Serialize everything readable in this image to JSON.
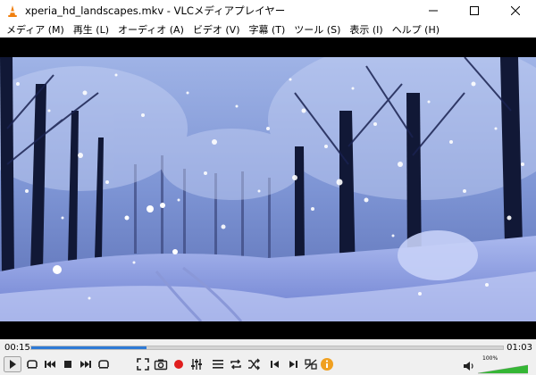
{
  "window": {
    "title": "xperia_hd_landscapes.mkv - VLCメディアプレイヤー"
  },
  "menu": [
    {
      "label": "メディア (M)"
    },
    {
      "label": "再生 (L)"
    },
    {
      "label": "オーディオ (A)"
    },
    {
      "label": "ビデオ (V)"
    },
    {
      "label": "字幕 (T)"
    },
    {
      "label": "ツール (S)"
    },
    {
      "label": "表示 (I)"
    },
    {
      "label": "ヘルプ (H)"
    }
  ],
  "playback": {
    "elapsed": "00:15",
    "total": "01:03",
    "progress": 0.245
  },
  "volume": {
    "label": "100%",
    "level": 1.0
  },
  "colors": {
    "accent": "#2d7ad6",
    "volume_fill": "#35b635",
    "record": "#e01e1e",
    "info": "#f0a020"
  },
  "icons": [
    "vlc-cone-icon",
    "play-icon",
    "pause-stop-icon",
    "previous-icon",
    "stop-icon",
    "next-icon",
    "fullscreen-icon",
    "extended-settings-icon",
    "playlist-icon",
    "loop-icon",
    "shuffle-icon",
    "frame-back-icon",
    "frame-forward-icon",
    "ab-loop-icon",
    "snapshot-icon",
    "record-icon",
    "info-icon",
    "speaker-icon"
  ]
}
